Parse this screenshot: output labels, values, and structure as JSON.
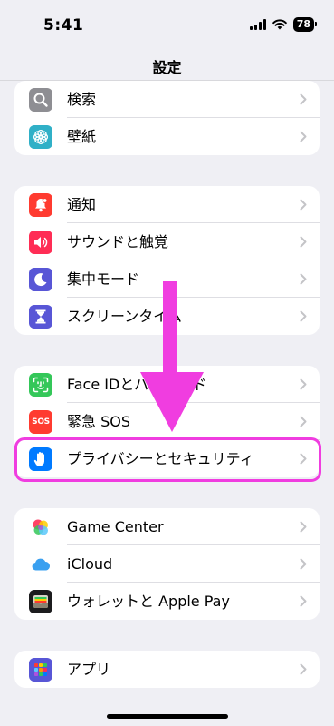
{
  "status_bar": {
    "time": "5:41",
    "battery": "78"
  },
  "nav": {
    "title": "設定"
  },
  "groups": [
    {
      "items": [
        {
          "label": "検索",
          "icon": "search-icon",
          "color": "#8e8e93"
        },
        {
          "label": "壁紙",
          "icon": "wallpaper-flower-icon",
          "color": "#30b0c7"
        }
      ]
    },
    {
      "items": [
        {
          "label": "通知",
          "icon": "bell-icon",
          "color": "#ff3b30"
        },
        {
          "label": "サウンドと触覚",
          "icon": "speaker-icon",
          "color": "#ff2d55"
        },
        {
          "label": "集中モード",
          "icon": "moon-icon",
          "color": "#5856d6"
        },
        {
          "label": "スクリーンタイム",
          "icon": "hourglass-icon",
          "color": "#5856d6"
        }
      ]
    },
    {
      "items": [
        {
          "label": "Face IDとパスコード",
          "icon": "face-id-icon",
          "color": "#34c759"
        },
        {
          "label": "緊急 SOS",
          "icon": "sos-icon",
          "color": "#ff3b30",
          "icon_text": "SOS"
        },
        {
          "label": "プライバシーとセキュリティ",
          "icon": "hand-icon",
          "color": "#007aff"
        }
      ]
    },
    {
      "items": [
        {
          "label": "Game Center",
          "icon": "game-center-icon",
          "color": "#ffffff"
        },
        {
          "label": "iCloud",
          "icon": "cloud-icon",
          "color": "#ffffff"
        },
        {
          "label": "ウォレットと Apple Pay",
          "icon": "wallet-icon",
          "color": "#1c1c1e"
        }
      ]
    },
    {
      "items": [
        {
          "label": "アプリ",
          "icon": "apps-grid-icon",
          "color": "#5856d6"
        }
      ]
    }
  ],
  "annotation": {
    "highlight_color": "#f03de0"
  }
}
